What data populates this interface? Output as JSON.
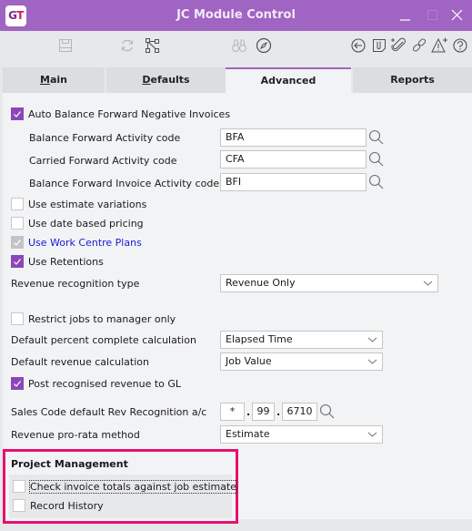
{
  "window": {
    "title": "JC Module Control",
    "logo": {
      "g": "G",
      "t": "T"
    },
    "controls": [
      "minimize",
      "maximize",
      "close"
    ]
  },
  "toolbar": {
    "left": [
      "save-icon",
      "refresh-icon",
      "hierarchy-icon"
    ],
    "middle": [
      "binoculars-icon",
      "compass-icon"
    ],
    "right": [
      "back-icon",
      "notes-icon",
      "add-attachment-icon",
      "link-icon",
      "add-alert-icon",
      "help-icon"
    ]
  },
  "tabs": [
    {
      "label_ul": "M",
      "label_rest": "ain",
      "active": false
    },
    {
      "label_ul": "D",
      "label_rest": "efaults",
      "active": false
    },
    {
      "label": "Advanced",
      "active": true
    },
    {
      "label": "Reports",
      "active": false
    }
  ],
  "advanced": {
    "auto_balance": {
      "label": "Auto Balance Forward Negative Invoices",
      "checked": true
    },
    "bf_activity": {
      "label": "Balance Forward Activity code",
      "value": "BFA"
    },
    "cf_activity": {
      "label": "Carried Forward Activity code",
      "value": "CFA"
    },
    "bfi_activity": {
      "label": "Balance Forward Invoice Activity code",
      "value": "BFI"
    },
    "use_estimate_variations": {
      "label": "Use estimate variations",
      "checked": false
    },
    "use_date_pricing": {
      "label": "Use date based pricing",
      "checked": false
    },
    "use_work_centre": {
      "label": "Use Work Centre Plans",
      "checked": true,
      "disabled": true
    },
    "use_retentions": {
      "label": "Use Retentions",
      "checked": true
    },
    "revenue_recognition_type": {
      "label": "Revenue recognition type",
      "value": "Revenue Only"
    },
    "restrict_jobs": {
      "label": "Restrict jobs to manager only",
      "checked": false
    },
    "default_percent": {
      "label": "Default percent complete calculation",
      "value": "Elapsed Time"
    },
    "default_revenue": {
      "label": "Default revenue calculation",
      "value": "Job Value"
    },
    "post_revenue_gl": {
      "label": "Post recognised revenue to GL",
      "checked": true
    },
    "sales_code": {
      "label": "Sales Code default Rev Recognition a/c",
      "seg1": "*",
      "sep1": ".",
      "seg2": "99",
      "sep2": ".",
      "seg3": "6710"
    },
    "pro_rata": {
      "label": "Revenue pro-rata method",
      "value": "Estimate"
    }
  },
  "project_management": {
    "title": "Project Management",
    "check_invoice": {
      "label": "Check invoice totals against job estimate",
      "checked": false
    },
    "record_history": {
      "label": "Record History",
      "checked": false
    }
  },
  "colors": {
    "accent": "#a064c3",
    "checkbox": "#8a47b8",
    "highlight": "#e6106f"
  }
}
